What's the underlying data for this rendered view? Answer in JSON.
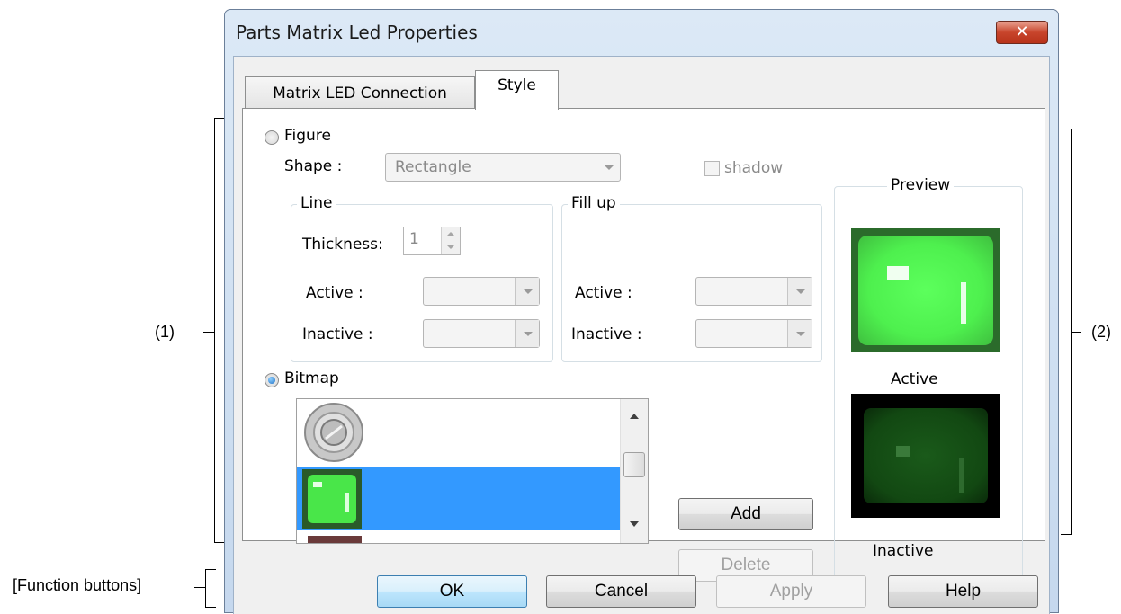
{
  "annotations": {
    "area1": "(1)",
    "area2": "(2)",
    "function_buttons": "[Function buttons]"
  },
  "window": {
    "title": "Parts Matrix Led Properties",
    "close_glyph": "✕"
  },
  "tabs": [
    {
      "label": "Matrix LED Connection",
      "active": false
    },
    {
      "label": "Style",
      "active": true
    }
  ],
  "figure": {
    "label": "Figure",
    "selected": false,
    "shape_label": "Shape :",
    "shape_value": "Rectangle",
    "shadow_label": "shadow",
    "shadow_checked": false,
    "line": {
      "legend": "Line",
      "thickness_label": "Thickness:",
      "thickness_value": "1",
      "active_label": "Active :",
      "inactive_label": "Inactive :"
    },
    "fill": {
      "legend": "Fill up",
      "active_label": "Active :",
      "inactive_label": "Inactive :"
    }
  },
  "bitmap": {
    "label": "Bitmap",
    "selected": true,
    "selected_index": 1
  },
  "list_buttons": {
    "add": "Add",
    "delete": "Delete"
  },
  "preview": {
    "legend": "Preview",
    "active_label": "Active",
    "inactive_label": "Inactive",
    "active_color": "#4dff4d",
    "inactive_color": "#0f4a0f"
  },
  "function_buttons": {
    "ok": "OK",
    "cancel": "Cancel",
    "apply": "Apply",
    "help": "Help"
  }
}
